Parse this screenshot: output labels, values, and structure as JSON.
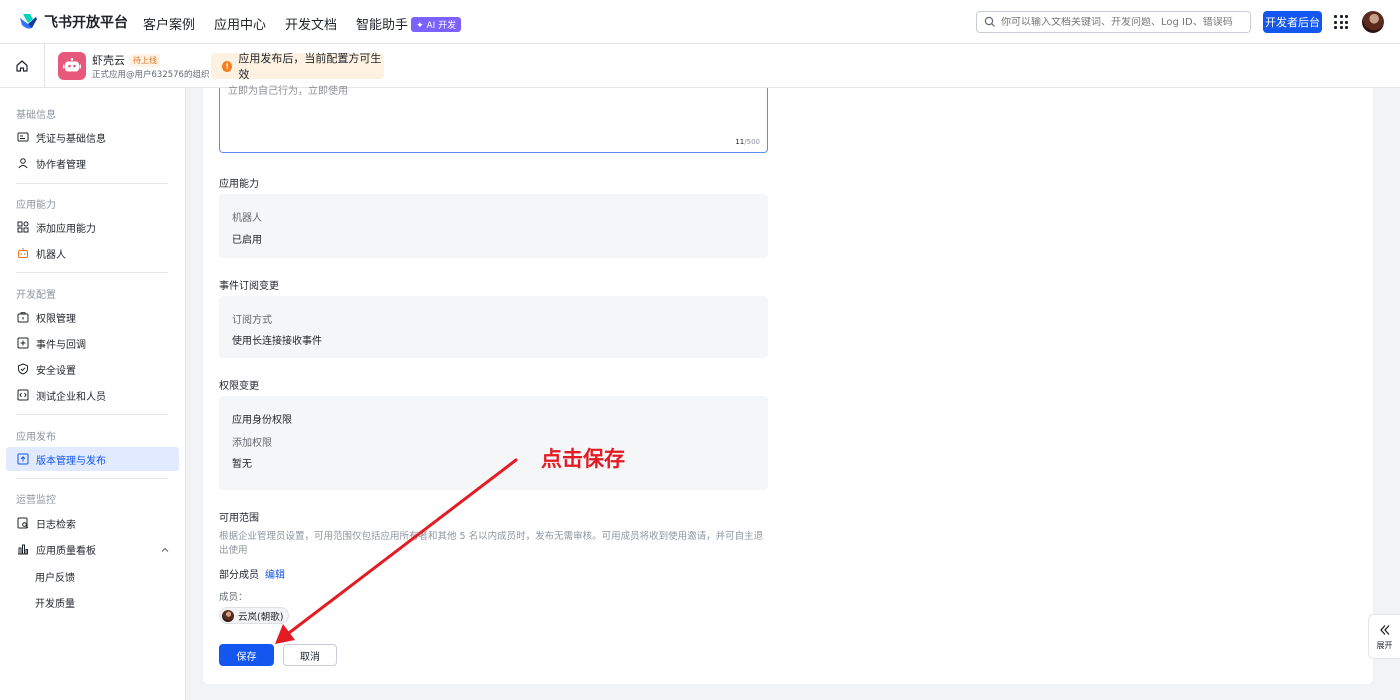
{
  "brand": {
    "name": "飞书开放平台"
  },
  "topnav": {
    "items": [
      "客户案例",
      "应用中心",
      "开发文档",
      "智能助手"
    ],
    "ai_badge": "✦ AI 开发"
  },
  "search": {
    "placeholder": "你可以输入文档关键词、开发问题、Log ID、错误码"
  },
  "dev_console_button": "开发者后台",
  "app": {
    "name": "虾壳云",
    "status": "待上线",
    "org": "正式应用@用户632576的组织"
  },
  "notice": {
    "icon": "!",
    "text": "应用发布后，当前配置方可生效"
  },
  "sidebar": {
    "groups": [
      "基础信息",
      "应用能力",
      "开发配置",
      "应用发布",
      "运营监控"
    ],
    "items": [
      {
        "label": "凭证与基础信息",
        "icon": "id-card-icon"
      },
      {
        "label": "协作者管理",
        "icon": "user-icon"
      },
      {
        "label": "添加应用能力",
        "icon": "apps-icon"
      },
      {
        "label": "机器人",
        "icon": "robot-icon"
      },
      {
        "label": "权限管理",
        "icon": "lock-box-icon"
      },
      {
        "label": "事件与回调",
        "icon": "plus-box-icon"
      },
      {
        "label": "安全设置",
        "icon": "shield-icon"
      },
      {
        "label": "测试企业和人员",
        "icon": "code-box-icon"
      },
      {
        "label": "版本管理与发布",
        "icon": "upload-box-icon"
      },
      {
        "label": "日志检索",
        "icon": "log-search-icon"
      },
      {
        "label": "应用质量看板",
        "icon": "bar-chart-icon"
      }
    ],
    "sub_items": [
      "用户反馈",
      "开发质量"
    ]
  },
  "form": {
    "textarea_partial": "立即为自己行为，立即使用",
    "char_count": "11",
    "char_max": "/500",
    "capability": {
      "title": "应用能力",
      "label": "机器人",
      "value": "已启用"
    },
    "events": {
      "title": "事件订阅变更",
      "label": "订阅方式",
      "value": "使用长连接接收事件"
    },
    "permissions": {
      "title": "权限变更",
      "label1": "应用身份权限",
      "label2": "添加权限",
      "value": "暂无"
    },
    "scope": {
      "title": "可用范围",
      "desc": "根据企业管理员设置，可用范围仅包括应用所有者和其他 5 名以内成员时，发布无需审核。可用成员将收到使用邀请，并可自主退出使用",
      "members_summary": "部分成员",
      "edit": "编辑",
      "members_label": "成员：",
      "member_name": "云岚(朝歌)"
    },
    "save": "保存",
    "cancel": "取消"
  },
  "annotation": {
    "text": "点击保存",
    "color": "#e31b23"
  },
  "expand": {
    "label": "展开"
  },
  "colors": {
    "primary": "#1456f0",
    "active_bg": "#e1eaff",
    "notice_bg": "#fdf1e2"
  }
}
